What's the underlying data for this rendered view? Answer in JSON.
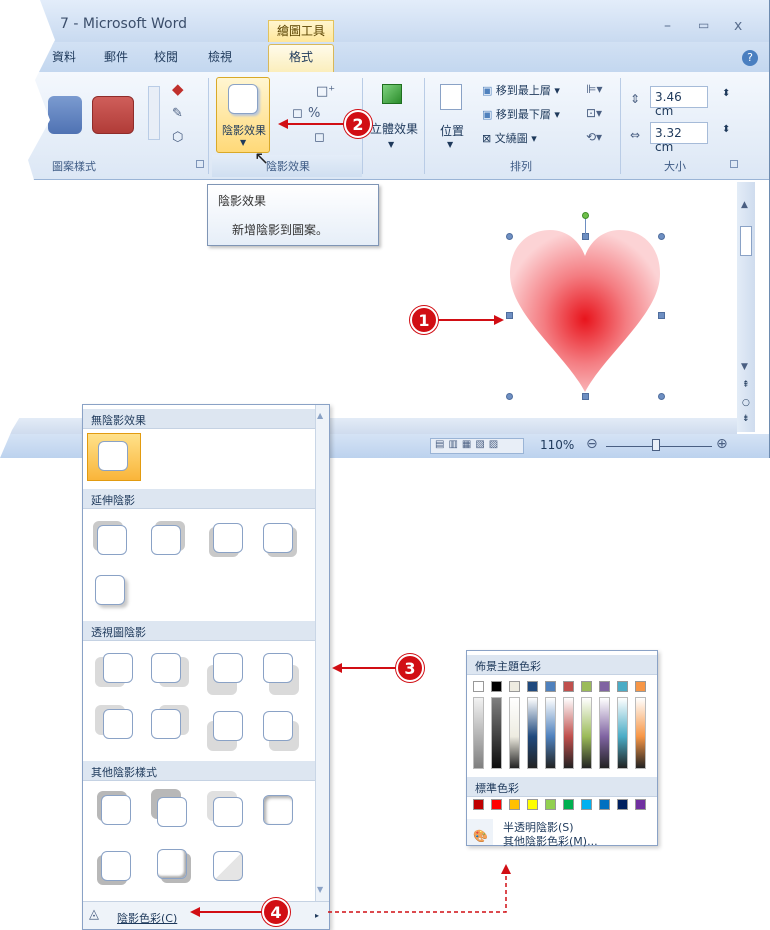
{
  "window": {
    "title": "7 - Microsoft Word",
    "context_tab": "繪圖工具",
    "controls": [
      "–",
      "▭",
      "x"
    ],
    "help": "?"
  },
  "tabs": [
    "資料",
    "郵件",
    "校閱",
    "檢視",
    "格式"
  ],
  "ribbon": {
    "group_shape_styles": "圖案樣式",
    "shadow_effects_button": "陰影效果",
    "shadow_effects_group": "陰影效果",
    "threed_effects_button": "立體效果",
    "position_button": "位置",
    "arrange": {
      "bring_front": "移到最上層",
      "send_back": "移到最下層",
      "text_wrap": "文繞圖",
      "group": "排列"
    },
    "size": {
      "height": "3.46 cm",
      "width": "3.32 cm",
      "group": "大小"
    }
  },
  "tooltip": {
    "title": "陰影效果",
    "description": "新增陰影到圖案。"
  },
  "statusbar": {
    "zoom": "110%"
  },
  "gallery": {
    "sections": [
      "無陰影效果",
      "延伸陰影",
      "透視圖陰影",
      "其他陰影樣式"
    ],
    "footer": "陰影色彩(C)"
  },
  "color_picker": {
    "theme_colors": "佈景主題色彩",
    "standard_colors": "標準色彩",
    "semi_transparent": "半透明陰影(S)",
    "more_colors": "其他陰影色彩(M)...",
    "theme_top": [
      "#ffffff",
      "#000000",
      "#eeece1",
      "#1f497d",
      "#4f81bd",
      "#c0504d",
      "#9bbb59",
      "#8064a2",
      "#4bacc6",
      "#f79646"
    ],
    "standard": [
      "#c00000",
      "#ff0000",
      "#ffc000",
      "#ffff00",
      "#92d050",
      "#00b050",
      "#00b0f0",
      "#0070c0",
      "#002060",
      "#7030a0"
    ]
  },
  "callouts": [
    "1",
    "2",
    "3",
    "4"
  ]
}
